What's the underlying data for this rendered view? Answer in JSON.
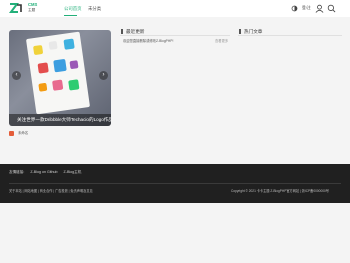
{
  "header": {
    "logo": {
      "brand": "Z",
      "cms": "CMS",
      "sub": "主题"
    },
    "nav": [
      {
        "label": "公司首页",
        "active": true
      },
      {
        "label": "未分类",
        "active": false
      }
    ],
    "login_label": "登/注",
    "accent_color": "#23b07a"
  },
  "slider": {
    "caption": "关注世界一款Dribbble大师Techacio的Logo作品",
    "prev": "‹",
    "next": "›"
  },
  "category": {
    "label": "未命名"
  },
  "recent": {
    "title": "最近更新",
    "items": [
      "欢迎您直接删除或修改Z-BlogPHP!"
    ],
    "more": "查看更多"
  },
  "hot": {
    "title": "热门文章"
  },
  "footer": {
    "links_label": "友情链接:",
    "links": [
      "Z-Blog on Github",
      "Z-Blog主机"
    ],
    "nav_text": "关于本站 | 网站地图 | 商业合作 | 广告投放 | 免责声明及意见",
    "copyright": "Copyright © 2021 卡卡主题 Z-BlogPHP官方网站 | 浙ICP备0000000号"
  }
}
